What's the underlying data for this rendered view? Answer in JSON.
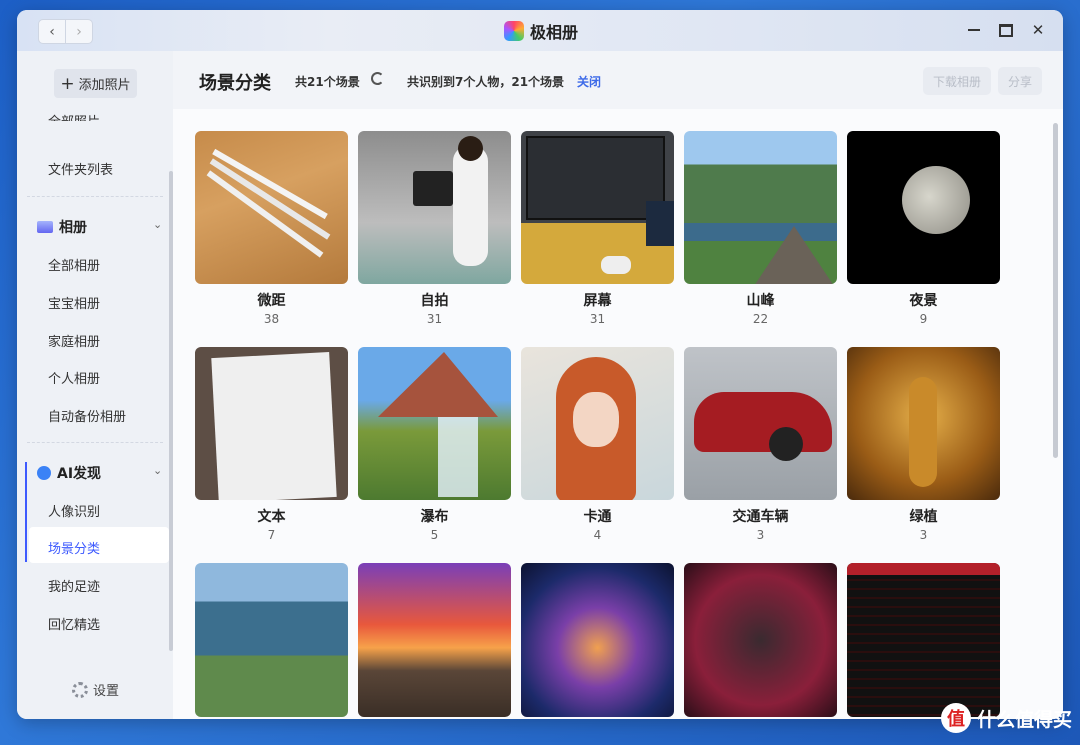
{
  "window": {
    "title": "极相册",
    "nav_back": "‹",
    "nav_forward": "›",
    "close_glyph": "✕"
  },
  "sidebar": {
    "add_photo": "添加照片",
    "add_icon": "plus-icon",
    "items_top": [
      "全部照片",
      "文件夹列表"
    ],
    "albums_section": "相册",
    "album_items": [
      "全部相册",
      "宝宝相册",
      "家庭相册",
      "个人相册",
      "自动备份相册"
    ],
    "ai_section": "AI发现",
    "ai_items": [
      "人像识别",
      "场景分类",
      "我的足迹",
      "回忆精选"
    ],
    "active_item": "场景分类",
    "settings": "设置"
  },
  "header": {
    "title": "场景分类",
    "scene_count": "共21个场景",
    "recognition": "共识别到7个人物，21个场景",
    "close_link": "关闭",
    "download_btn": "下载相册",
    "share_btn": "分享"
  },
  "scenes": [
    {
      "name": "微距",
      "count": "38"
    },
    {
      "name": "自拍",
      "count": "31"
    },
    {
      "name": "屏幕",
      "count": "31"
    },
    {
      "name": "山峰",
      "count": "22"
    },
    {
      "name": "夜景",
      "count": "9"
    },
    {
      "name": "文本",
      "count": "7"
    },
    {
      "name": "瀑布",
      "count": "5"
    },
    {
      "name": "卡通",
      "count": "4"
    },
    {
      "name": "交通车辆",
      "count": "3"
    },
    {
      "name": "绿植",
      "count": "3"
    },
    {
      "name": "",
      "count": ""
    },
    {
      "name": "",
      "count": ""
    },
    {
      "name": "",
      "count": ""
    },
    {
      "name": "",
      "count": ""
    },
    {
      "name": "",
      "count": ""
    }
  ],
  "watermark": {
    "logo": "值",
    "text": "什么值得买"
  },
  "colors": {
    "accent": "#3d6ae8",
    "desktop": "#2f78d8"
  }
}
